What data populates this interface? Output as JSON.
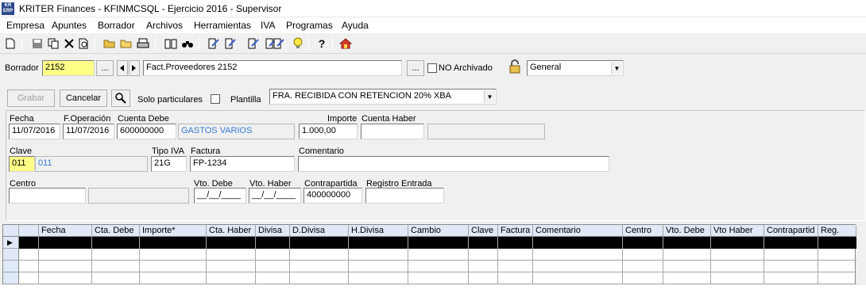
{
  "window": {
    "title": "KRITER Finances - KFINMCSQL - Ejercicio 2016 - Supervisor",
    "app_icon_text": "KR ERP"
  },
  "menu": [
    "Empresa",
    "Apuntes",
    "Borrador",
    "Archivos",
    "Herramientas",
    "IVA",
    "Programas",
    "Ayuda"
  ],
  "borrador": {
    "label": "Borrador",
    "value": "2152",
    "browse": "...",
    "description": "Fact.Proveedores 2152",
    "browse2": "...",
    "no_archivado": "NO Archivado",
    "diario": "General"
  },
  "actions": {
    "grabar": "Grabar",
    "cancelar": "Cancelar",
    "solo_particulares": "Solo particulares",
    "plantilla_label": "Plantilla",
    "plantilla_value": "FRA. RECIBIDA CON RETENCION 20% XBA"
  },
  "form": {
    "fecha_label": "Fecha",
    "fecha": "11/07/2016",
    "foperacion_label": "F.Operación",
    "foperacion": "11/07/2016",
    "cuenta_debe_label": "Cuenta Debe",
    "cuenta_debe": "600000000",
    "cuenta_debe_desc": "GASTOS VARIOS",
    "importe_label": "Importe",
    "importe": "1.000,00",
    "cuenta_haber_label": "Cuenta Haber",
    "cuenta_haber": "",
    "clave_label": "Clave",
    "clave": "011",
    "clave_desc": "011",
    "tipo_iva_label": "Tipo IVA",
    "tipo_iva": "21G",
    "factura_label": "Factura",
    "factura": "FP-1234",
    "comentario_label": "Comentario",
    "comentario": "",
    "centro_label": "Centro",
    "vto_debe_label": "Vto. Debe",
    "vto_debe": "__/__/____",
    "vto_haber_label": "Vto. Haber",
    "vto_haber": "__/__/____",
    "contrapartida_label": "Contrapartida",
    "contrapartida": "400000000",
    "registro_entrada_label": "Registro  Entrada"
  },
  "grid": {
    "columns": [
      "Fecha",
      "Cta. Debe",
      "Importe*",
      "Cta. Haber",
      "Divisa",
      "D.Divisa",
      "H.Divisa",
      "Cambio",
      "Clave",
      "Factura",
      "Comentario",
      "Centro",
      "Vto. Debe",
      "Vto Haber",
      "Contrapartid",
      "Reg."
    ],
    "row_indicator": "▶"
  },
  "colors": {
    "highlight_yellow": "#ffff88",
    "link_blue": "#3a7bd5",
    "grid_header": "#dfe9f7"
  }
}
